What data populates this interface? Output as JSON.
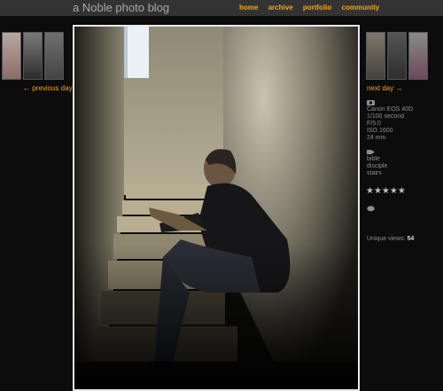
{
  "site_title": "a Noble photo blog",
  "nav": [
    "home",
    "archive",
    "portfolio",
    "community"
  ],
  "prev_link": "← previous day",
  "next_link": "next day →",
  "exif": [
    "Canon EOS 40D",
    "1/100 second",
    "F/5.0",
    "ISO 1600",
    "24 mm"
  ],
  "tags": [
    "bible",
    "disciple",
    "stairs"
  ],
  "rating_stars": "★★★★★",
  "views_label": "Unique views:",
  "views_count": "54",
  "colors": {
    "accent": "#f5a51e",
    "topbar": "#333333",
    "background": "#0c0c0c"
  }
}
